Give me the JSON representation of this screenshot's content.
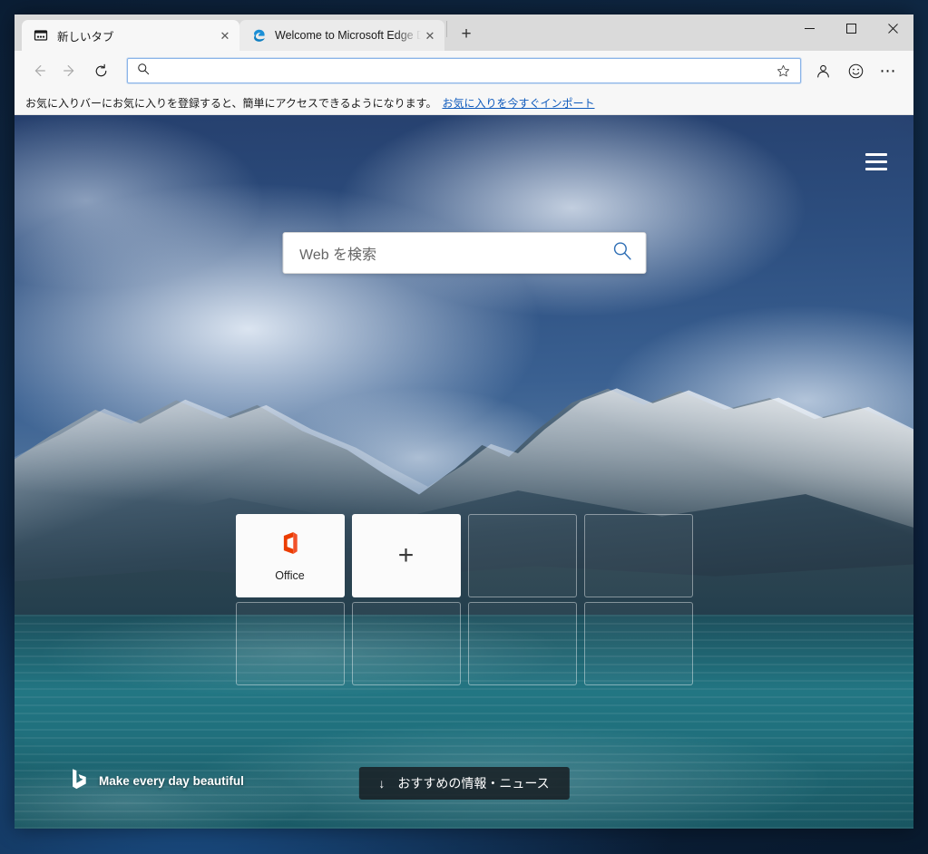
{
  "window": {
    "controls": {
      "minimize": "─",
      "maximize": "□",
      "close": "✕"
    }
  },
  "tabs": {
    "items": [
      {
        "title": "新しいタブ",
        "favicon": "newtab-icon",
        "close": "✕",
        "active": true
      },
      {
        "title": "Welcome to Microsoft Edge Dev",
        "favicon": "edge-icon",
        "close": "✕",
        "active": false
      }
    ],
    "new_tab_label": "+"
  },
  "toolbar": {
    "back_label": "←",
    "forward_label": "→",
    "refresh_label": "↻",
    "address": {
      "value": "",
      "placeholder": ""
    },
    "favorite_label": "☆",
    "profile_label": "profile-icon",
    "feedback_label": "feedback-icon",
    "settings_label": "⋯"
  },
  "favorites_bar": {
    "message": "お気に入りバーにお気に入りを登録すると、簡単にアクセスできるようになります。",
    "link": "お気に入りを今すぐインポート"
  },
  "newtab": {
    "menu_label": "hamburger-menu-icon",
    "search": {
      "value": "",
      "placeholder": "Web を検索",
      "button_label": "search-icon"
    },
    "tiles": [
      {
        "label": "Office",
        "type": "filled",
        "icon": "office-icon"
      },
      {
        "label": "+",
        "type": "filled",
        "icon": "plus-icon"
      },
      {
        "label": "",
        "type": "empty",
        "icon": ""
      },
      {
        "label": "",
        "type": "empty",
        "icon": ""
      },
      {
        "label": "",
        "type": "empty",
        "icon": ""
      },
      {
        "label": "",
        "type": "empty",
        "icon": ""
      },
      {
        "label": "",
        "type": "empty",
        "icon": ""
      },
      {
        "label": "",
        "type": "empty",
        "icon": ""
      }
    ],
    "bing": {
      "logo": "bing-logo",
      "tagline": "Make every day beautiful"
    },
    "news": {
      "arrow": "↓",
      "label": "おすすめの情報・ニュース"
    }
  },
  "colors": {
    "accent_link": "#0f5bbd",
    "address_border": "#8ab4e8",
    "office_orange": "#eb3c00",
    "titlebar_bg": "#dadada",
    "toolbar_bg": "#f7f7f7",
    "news_pill_bg": "rgba(22,26,30,0.82)"
  }
}
